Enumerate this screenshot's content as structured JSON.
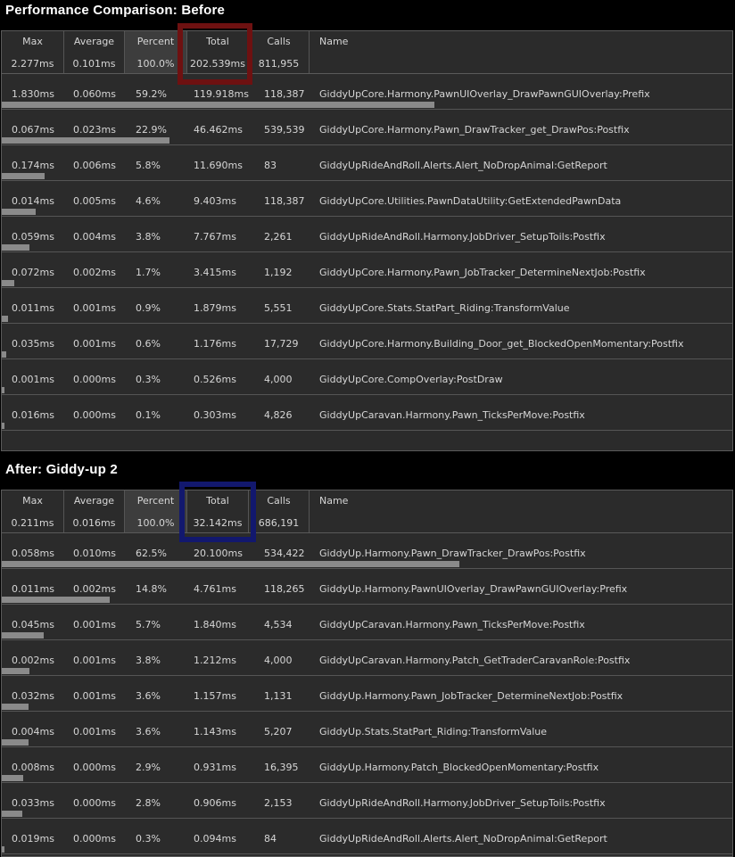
{
  "before": {
    "title": "Performance Comparison: Before",
    "columns": [
      "Max",
      "Average",
      "Percent",
      "Total",
      "Calls",
      "Name"
    ],
    "summary": [
      "2.277ms",
      "0.101ms",
      "100.0%",
      "202.539ms",
      "811,955"
    ],
    "highlight_color": "#6e1111",
    "rows": [
      {
        "max": "1.830ms",
        "avg": "0.060ms",
        "pct": "59.2%",
        "total": "119.918ms",
        "calls": "118,387",
        "name": "GiddyUpCore.Harmony.PawnUIOverlay_DrawPawnGUIOverlay:Prefix",
        "frac": 0.592
      },
      {
        "max": "0.067ms",
        "avg": "0.023ms",
        "pct": "22.9%",
        "total": "46.462ms",
        "calls": "539,539",
        "name": "GiddyUpCore.Harmony.Pawn_DrawTracker_get_DrawPos:Postfix",
        "frac": 0.229
      },
      {
        "max": "0.174ms",
        "avg": "0.006ms",
        "pct": "5.8%",
        "total": "11.690ms",
        "calls": "83",
        "name": "GiddyUpRideAndRoll.Alerts.Alert_NoDropAnimal:GetReport",
        "frac": 0.058
      },
      {
        "max": "0.014ms",
        "avg": "0.005ms",
        "pct": "4.6%",
        "total": "9.403ms",
        "calls": "118,387",
        "name": "GiddyUpCore.Utilities.PawnDataUtility:GetExtendedPawnData",
        "frac": 0.046
      },
      {
        "max": "0.059ms",
        "avg": "0.004ms",
        "pct": "3.8%",
        "total": "7.767ms",
        "calls": "2,261",
        "name": "GiddyUpRideAndRoll.Harmony.JobDriver_SetupToils:Postfix",
        "frac": 0.038
      },
      {
        "max": "0.072ms",
        "avg": "0.002ms",
        "pct": "1.7%",
        "total": "3.415ms",
        "calls": "1,192",
        "name": "GiddyUpCore.Harmony.Pawn_JobTracker_DetermineNextJob:Postfix",
        "frac": 0.017
      },
      {
        "max": "0.011ms",
        "avg": "0.001ms",
        "pct": "0.9%",
        "total": "1.879ms",
        "calls": "5,551",
        "name": "GiddyUpCore.Stats.StatPart_Riding:TransformValue",
        "frac": 0.009
      },
      {
        "max": "0.035ms",
        "avg": "0.001ms",
        "pct": "0.6%",
        "total": "1.176ms",
        "calls": "17,729",
        "name": "GiddyUpCore.Harmony.Building_Door_get_BlockedOpenMomentary:Postfix",
        "frac": 0.006
      },
      {
        "max": "0.001ms",
        "avg": "0.000ms",
        "pct": "0.3%",
        "total": "0.526ms",
        "calls": "4,000",
        "name": "GiddyUpCore.CompOverlay:PostDraw",
        "frac": 0.003
      },
      {
        "max": "0.016ms",
        "avg": "0.000ms",
        "pct": "0.1%",
        "total": "0.303ms",
        "calls": "4,826",
        "name": "GiddyUpCaravan.Harmony.Pawn_TicksPerMove:Postfix",
        "frac": 0.001
      }
    ]
  },
  "after": {
    "title": "After: Giddy-up 2",
    "columns": [
      "Max",
      "Average",
      "Percent",
      "Total",
      "Calls",
      "Name"
    ],
    "summary": [
      "0.211ms",
      "0.016ms",
      "100.0%",
      "32.142ms",
      "686,191"
    ],
    "highlight_color": "#12186e",
    "rows": [
      {
        "max": "0.058ms",
        "avg": "0.010ms",
        "pct": "62.5%",
        "total": "20.100ms",
        "calls": "534,422",
        "name": "GiddyUp.Harmony.Pawn_DrawTracker_DrawPos:Postfix",
        "frac": 0.625
      },
      {
        "max": "0.011ms",
        "avg": "0.002ms",
        "pct": "14.8%",
        "total": "4.761ms",
        "calls": "118,265",
        "name": "GiddyUp.Harmony.PawnUIOverlay_DrawPawnGUIOverlay:Prefix",
        "frac": 0.148
      },
      {
        "max": "0.045ms",
        "avg": "0.001ms",
        "pct": "5.7%",
        "total": "1.840ms",
        "calls": "4,534",
        "name": "GiddyUpCaravan.Harmony.Pawn_TicksPerMove:Postfix",
        "frac": 0.057
      },
      {
        "max": "0.002ms",
        "avg": "0.001ms",
        "pct": "3.8%",
        "total": "1.212ms",
        "calls": "4,000",
        "name": "GiddyUpCaravan.Harmony.Patch_GetTraderCaravanRole:Postfix",
        "frac": 0.038
      },
      {
        "max": "0.032ms",
        "avg": "0.001ms",
        "pct": "3.6%",
        "total": "1.157ms",
        "calls": "1,131",
        "name": "GiddyUp.Harmony.Pawn_JobTracker_DetermineNextJob:Postfix",
        "frac": 0.036
      },
      {
        "max": "0.004ms",
        "avg": "0.001ms",
        "pct": "3.6%",
        "total": "1.143ms",
        "calls": "5,207",
        "name": "GiddyUp.Stats.StatPart_Riding:TransformValue",
        "frac": 0.036
      },
      {
        "max": "0.008ms",
        "avg": "0.000ms",
        "pct": "2.9%",
        "total": "0.931ms",
        "calls": "16,395",
        "name": "GiddyUp.Harmony.Patch_BlockedOpenMomentary:Postfix",
        "frac": 0.029
      },
      {
        "max": "0.033ms",
        "avg": "0.000ms",
        "pct": "2.8%",
        "total": "0.906ms",
        "calls": "2,153",
        "name": "GiddyUpRideAndRoll.Harmony.JobDriver_SetupToils:Postfix",
        "frac": 0.028
      },
      {
        "max": "0.019ms",
        "avg": "0.000ms",
        "pct": "0.3%",
        "total": "0.094ms",
        "calls": "84",
        "name": "GiddyUpRideAndRoll.Alerts.Alert_NoDropAnimal:GetReport",
        "frac": 0.003
      }
    ]
  }
}
